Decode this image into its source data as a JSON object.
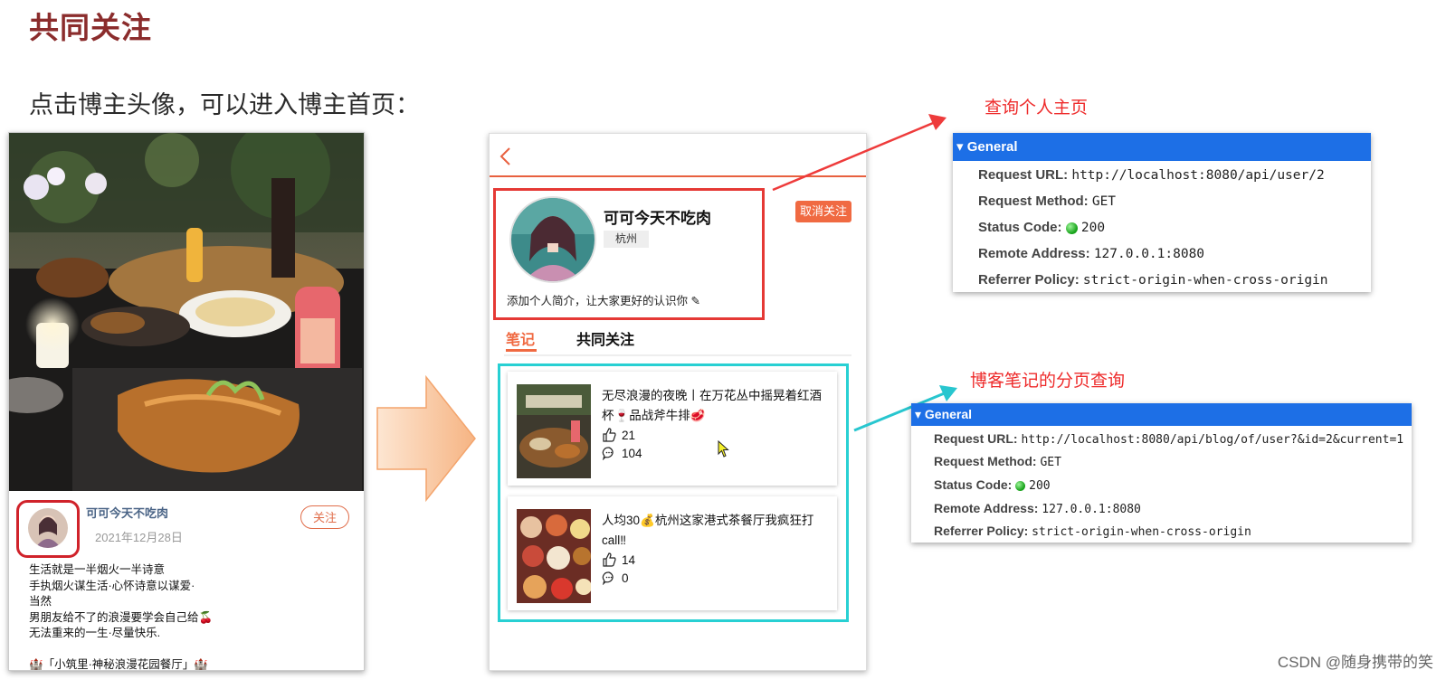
{
  "slide": {
    "title": "共同关注",
    "subtitle": "点击博主头像，可以进入博主首页："
  },
  "left_phone": {
    "author_name": "可可今天不吃肉",
    "post_date": "2021年12月28日",
    "follow_label": "关注",
    "caption_lines": [
      "生活就是一半烟火一半诗意",
      "手执烟火谋生活·心怀诗意以谋爱·",
      "当然",
      "男朋友给不了的浪漫要学会自己给🍒",
      "无法重来的一生·尽量快乐.",
      "",
      "🏰「小筑里·神秘浪漫花园餐厅」🏰"
    ]
  },
  "right_phone": {
    "profile_name": "可可今天不吃肉",
    "city": "杭州",
    "intro": "添加个人简介，让大家更好的认识你 ✎",
    "unfollow_label": "取消关注",
    "tabs": [
      "笔记",
      "共同关注"
    ],
    "notes": [
      {
        "title": "无尽浪漫的夜晚丨在万花丛中摇晃着红酒杯🍷品战斧牛排🥩",
        "likes": "21",
        "comments": "104"
      },
      {
        "title": "人均30💰杭州这家港式茶餐厅我疯狂打call‼",
        "likes": "14",
        "comments": "0"
      }
    ]
  },
  "annotations": {
    "user_label": "查询个人主页",
    "blog_label": "博客笔记的分页查询"
  },
  "panel_user": {
    "header": "▾ General",
    "rows": [
      {
        "key": "Request URL:",
        "value": "http://localhost:8080/api/user/2"
      },
      {
        "key": "Request Method:",
        "value": "GET"
      },
      {
        "key": "Status Code:",
        "value": "200"
      },
      {
        "key": "Remote Address:",
        "value": "127.0.0.1:8080"
      },
      {
        "key": "Referrer Policy:",
        "value": "strict-origin-when-cross-origin"
      }
    ]
  },
  "panel_blog": {
    "header": "▾ General",
    "rows": [
      {
        "key": "Request URL:",
        "value": "http://localhost:8080/api/blog/of/user?&id=2&current=1"
      },
      {
        "key": "Request Method:",
        "value": "GET"
      },
      {
        "key": "Status Code:",
        "value": "200"
      },
      {
        "key": "Remote Address:",
        "value": "127.0.0.1:8080"
      },
      {
        "key": "Referrer Policy:",
        "value": "strict-origin-when-cross-origin"
      }
    ]
  },
  "colors": {
    "title": "#8b2c2c",
    "accent_orange": "#f06a42",
    "highlight_red": "#e53935",
    "highlight_cyan": "#28d0d3",
    "devtools_blue": "#1d6fe6"
  },
  "watermark": "CSDN @随身携带的笑"
}
